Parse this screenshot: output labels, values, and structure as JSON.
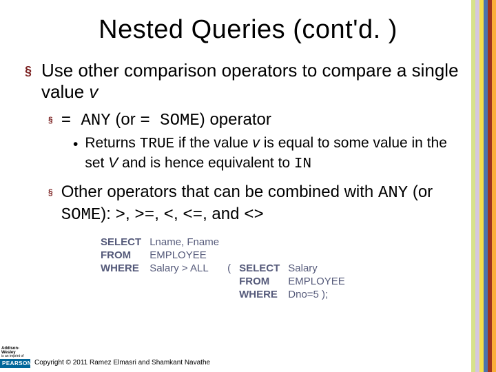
{
  "title": "Nested Queries (cont'd. )",
  "b1_pre": "Use other comparison operators to compare a single value ",
  "b1_v": "v",
  "b2a_op1": "= ANY",
  "b2a_mid": " (or ",
  "b2a_op2": "= SOME",
  "b2a_post": ") operator",
  "b3_pre": "Returns ",
  "b3_true": "TRUE",
  "b3_mid1": " if the value ",
  "b3_v": "v",
  "b3_mid2": " is equal to some value in the set ",
  "b3_V": "V",
  "b3_mid3": " and is hence equivalent to ",
  "b3_in": "IN",
  "b2b_pre": "Other operators that can be combined with ",
  "b2b_any": "ANY",
  "b2b_mid1": " (or ",
  "b2b_some": "SOME",
  "b2b_mid2": "): ",
  "b2b_o1": ">",
  "b2b_c": ", ",
  "b2b_o2": ">=",
  "b2b_o3": "<",
  "b2b_o4": "<=",
  "b2b_and": ", and ",
  "b2b_o5": "<>",
  "sql": {
    "k_select": "SELECT",
    "k_from": "FROM",
    "k_where": "WHERE",
    "o_cols": "Lname, Fname",
    "o_table": "EMPLOYEE",
    "o_cond": "Salary > ALL",
    "paren_open": "(",
    "i_cols": "Salary",
    "i_table": "EMPLOYEE",
    "i_cond": "Dno=5 );"
  },
  "logo": {
    "aw": "Addison-Wesley",
    "aw2": "is an imprint of",
    "pearson": "PEARSON"
  },
  "copyright": "Copyright © 2011 Ramez Elmasri and Shamkant Navathe"
}
